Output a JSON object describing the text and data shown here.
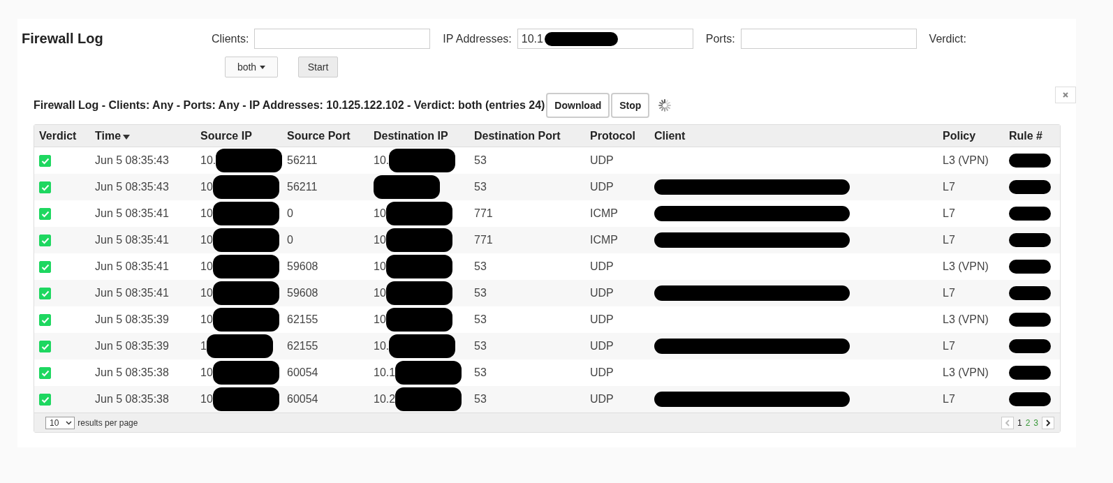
{
  "title": "Firewall Log",
  "filters": [
    {
      "kind": "input",
      "label": "Clients:",
      "redacted": false
    },
    {
      "kind": "input",
      "label": "IP Addresses:",
      "value": "10.1",
      "redacted": true
    },
    {
      "kind": "input",
      "label": "Ports:",
      "redacted": false
    },
    {
      "kind": "label",
      "label": "Verdict:"
    }
  ],
  "verdict_dropdown": "both",
  "start_button": "Start",
  "heading": "Firewall Log - Clients: Any - Ports: Any - IP Addresses: 10.125.122.102 - Verdict: both (entries 24)",
  "download_button": "Download",
  "stop_button": "Stop",
  "loading": true,
  "table": {
    "columns": [
      {
        "label": "Verdict",
        "sorted": false
      },
      {
        "label": "Time",
        "sorted": true
      },
      {
        "label": "Source IP",
        "sorted": false
      },
      {
        "label": "Source Port",
        "sorted": false
      },
      {
        "label": "Destination IP",
        "sorted": false
      },
      {
        "label": "Destination Port",
        "sorted": false
      },
      {
        "label": "Protocol",
        "sorted": false
      },
      {
        "label": "Client",
        "sorted": false
      },
      {
        "label": "Policy",
        "sorted": false
      },
      {
        "label": "Rule #",
        "sorted": false
      }
    ],
    "rows": [
      {
        "checked": true,
        "time": "Jun 5 08:35:43",
        "source_ip": "10.",
        "source_port": "56211",
        "destination_ip": "10.",
        "destination_port": "53",
        "protocol": "UDP",
        "client_redacted": false,
        "policy": "L3 (VPN)"
      },
      {
        "checked": true,
        "time": "Jun 5 08:35:43",
        "source_ip": "10",
        "source_port": "56211",
        "destination_port": "53",
        "protocol": "UDP",
        "client_redacted": true,
        "policy": "L7"
      },
      {
        "checked": true,
        "time": "Jun 5 08:35:41",
        "source_ip": "10",
        "source_port": "0",
        "destination_ip": "10",
        "destination_port": "771",
        "protocol": "ICMP",
        "client_redacted": true,
        "policy": "L7"
      },
      {
        "checked": true,
        "time": "Jun 5 08:35:41",
        "source_ip": "10",
        "source_port": "0",
        "destination_ip": "10",
        "destination_port": "771",
        "protocol": "ICMP",
        "client_redacted": true,
        "policy": "L7"
      },
      {
        "checked": true,
        "time": "Jun 5 08:35:41",
        "source_ip": "10",
        "source_port": "59608",
        "destination_ip": "10",
        "destination_port": "53",
        "protocol": "UDP",
        "client_redacted": false,
        "policy": "L3 (VPN)"
      },
      {
        "checked": true,
        "time": "Jun 5 08:35:41",
        "source_ip": "10",
        "source_port": "59608",
        "destination_ip": "10",
        "destination_port": "53",
        "protocol": "UDP",
        "client_redacted": true,
        "policy": "L7"
      },
      {
        "checked": true,
        "time": "Jun 5 08:35:39",
        "source_ip": "10",
        "source_port": "62155",
        "destination_ip": "10",
        "destination_port": "53",
        "protocol": "UDP",
        "client_redacted": false,
        "policy": "L3 (VPN)"
      },
      {
        "checked": true,
        "time": "Jun 5 08:35:39",
        "source_ip": "1",
        "source_port": "62155",
        "destination_ip": "10.",
        "destination_port": "53",
        "protocol": "UDP",
        "client_redacted": true,
        "policy": "L7"
      },
      {
        "checked": true,
        "time": "Jun 5 08:35:38",
        "source_ip": "10",
        "source_port": "60054",
        "destination_ip": "10.1",
        "destination_port": "53",
        "protocol": "UDP",
        "client_redacted": false,
        "policy": "L3 (VPN)"
      },
      {
        "checked": true,
        "time": "Jun 5 08:35:38",
        "source_ip": "10",
        "source_port": "60054",
        "destination_ip": "10.2",
        "destination_port": "53",
        "protocol": "UDP",
        "client_redacted": true,
        "policy": "L7"
      }
    ]
  },
  "page_size": "10",
  "page_size_label": "results per page",
  "pages": [
    {
      "label": "1",
      "selected": true
    },
    {
      "label": "2",
      "selected": false
    },
    {
      "label": "3",
      "selected": false
    }
  ]
}
